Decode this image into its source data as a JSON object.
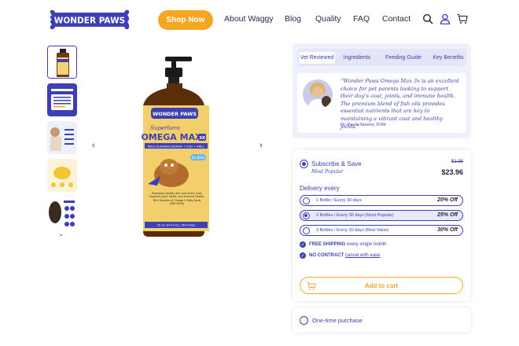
{
  "header": {
    "logo_text": "WONDER PAWS",
    "shop_button": "Shop Now",
    "nav": [
      "About Waggy",
      "Blog",
      "Quality",
      "FAQ",
      "Contact"
    ],
    "icons": [
      "search-icon",
      "user-icon",
      "cart-icon"
    ]
  },
  "gallery": {
    "thumbnails": [
      "product-bottle",
      "nutrition-chart",
      "dog-photo",
      "omega-capsule",
      "dog-benefits"
    ],
    "more_icon": "chevron-down-icon",
    "prev_icon": "chevron-left-icon",
    "next_icon": "chevron-right-icon"
  },
  "product_label": {
    "brand": "WONDER PAWS",
    "tagline": "Superhero",
    "name": "OMEGA MAX",
    "badge": "3X",
    "subline": "WILD ALASKAN SALMON + COD + KRILL",
    "sticker": "Fin Bath",
    "benefits": "Promotes Healthy Skin and Shiny Coat, Supports Joint, Heart, and Immune Health. Rich Sources of Omega 3 Fatty Acids (EPA+DHA)",
    "size": "16 oz (473 mL) | 96 Pumps"
  },
  "review": {
    "tabs": [
      "Vet Reviewed",
      "Ingredients",
      "Feeding Guide",
      "Key Benefits"
    ],
    "active_tab": "Vet Reviewed",
    "quote": "“Wonder Paws Omega Max 3x is an excellent choice for pet parents looking to support their dog’s coat, joints, and immune health. The premium blend of fish oils provides essential nutrients that are key to maintaining a vibrant coat and healthy joints.”",
    "author": "Dr. Paula Simons, DVM"
  },
  "subscription": {
    "title": "Subscribe & Save",
    "popular": "Most Popular",
    "price_old": "$1.95",
    "price_new": "$23.96",
    "delivery_title": "Delivery every",
    "options": [
      {
        "label": "1 Bottle / Every 30 days",
        "discount": "20% Off",
        "selected": false
      },
      {
        "label": "2 Bottles / Every 30 days (Most Popular)",
        "discount": "25% Off",
        "selected": true
      },
      {
        "label": "3 Bottles / Every 30 days (Best Value)",
        "discount": "30% Off",
        "selected": false
      }
    ],
    "perks": [
      {
        "bold": "FREE SHIPPING",
        "rest": " every single month",
        "link": ""
      },
      {
        "bold": "NO CONTRACT",
        "rest": " ",
        "link": "cancel with ease"
      }
    ],
    "cart_button": "Add to cart"
  },
  "one_time": {
    "label": "One-time purchase"
  },
  "colors": {
    "brand_purple": "#3d3fb5",
    "accent_orange": "#f6a623",
    "panel_bg": "#eef0fb"
  }
}
